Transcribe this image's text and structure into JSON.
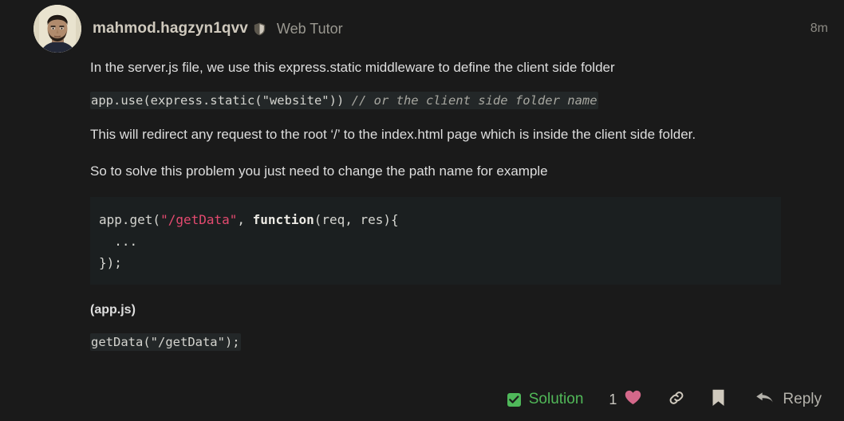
{
  "post": {
    "author": {
      "username": "mahmod.hagzyn1qvv",
      "badge_icon": "shield-icon",
      "title": "Web Tutor",
      "avatar_icon": "user-avatar-photo"
    },
    "timestamp": "8m",
    "body": {
      "paragraph_1": "In the server.js file, we use this express.static middleware to define the client side folder",
      "inline_code_1": {
        "code": "app.use(express.static(\"website\")) ",
        "comment": "// or the client side folder name"
      },
      "paragraph_2": "This will redirect any request to the root ‘/’ to the index.html page which is inside the client side folder.",
      "paragraph_3": "So to solve this problem you just need to change the path name for example",
      "code_block": {
        "line_1_part_1": "app.get(",
        "line_1_string": "\"/getData\"",
        "line_1_part_2": ", ",
        "line_1_keyword": "function",
        "line_1_part_3": "(req, res){",
        "line_2": "  ...",
        "line_3": "});"
      },
      "paragraph_4": "(app.js)",
      "inline_code_2": "getData(\"/getData\");"
    },
    "footer": {
      "solution_label": "Solution",
      "solution_icon": "check-icon",
      "like_count": "1",
      "like_icon": "heart-icon",
      "link_icon": "link-icon",
      "bookmark_icon": "bookmark-icon",
      "reply_icon": "reply-arrow-icon",
      "reply_label": "Reply"
    }
  },
  "colors": {
    "page_background": "#1a1a1a",
    "code_block_background": "#1b1f20",
    "inline_code_background": "#232728",
    "solution_green": "#4fb85a",
    "string_pink": "#e34a6f",
    "heart_pink": "#d4688a",
    "icon_beige": "#cfc9bd"
  }
}
